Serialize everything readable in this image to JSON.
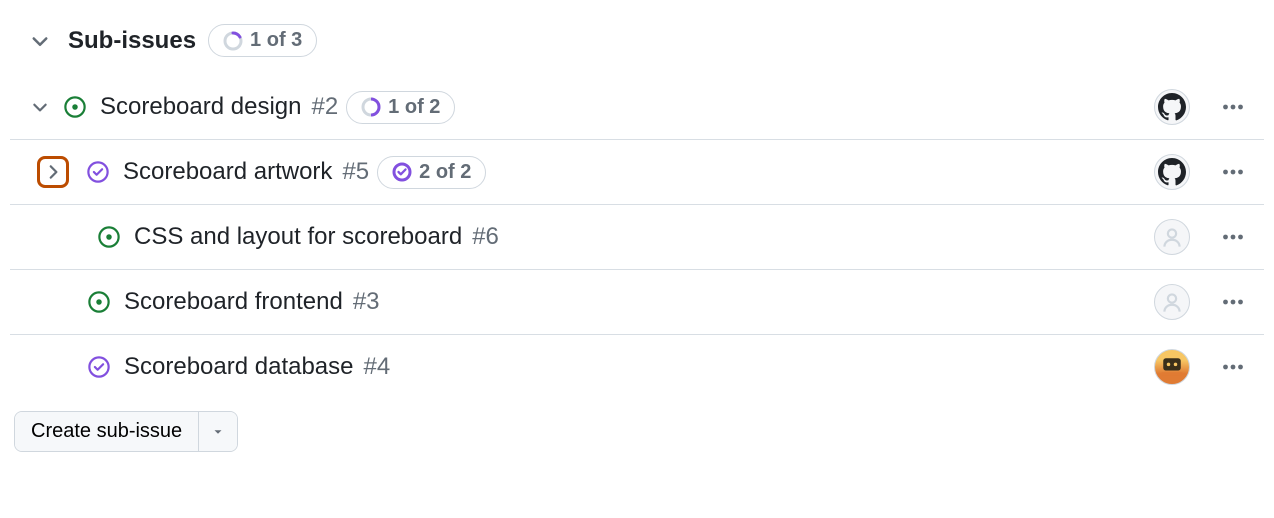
{
  "header": {
    "title": "Sub-issues",
    "count_label": "1 of 3"
  },
  "rows": [
    {
      "title": "Scoreboard design",
      "num": "#2",
      "badge": "1 of 2",
      "state": "open",
      "avatar": "octocat",
      "level": 1,
      "expand": "down"
    },
    {
      "title": "Scoreboard artwork",
      "num": "#5",
      "badge": "2 of 2",
      "state": "closed",
      "avatar": "octocat",
      "level": 2,
      "expand": "right",
      "highlight": true
    },
    {
      "title": "CSS and layout for scoreboard",
      "num": "#6",
      "badge": null,
      "state": "open",
      "avatar": "none",
      "level": 3,
      "expand": null
    },
    {
      "title": "Scoreboard frontend",
      "num": "#3",
      "badge": null,
      "state": "open",
      "avatar": "none",
      "level": 1,
      "expand": null
    },
    {
      "title": "Scoreboard database",
      "num": "#4",
      "badge": null,
      "state": "closed",
      "avatar": "hubot",
      "level": 1,
      "expand": null
    }
  ],
  "footer": {
    "create_label": "Create sub-issue"
  }
}
